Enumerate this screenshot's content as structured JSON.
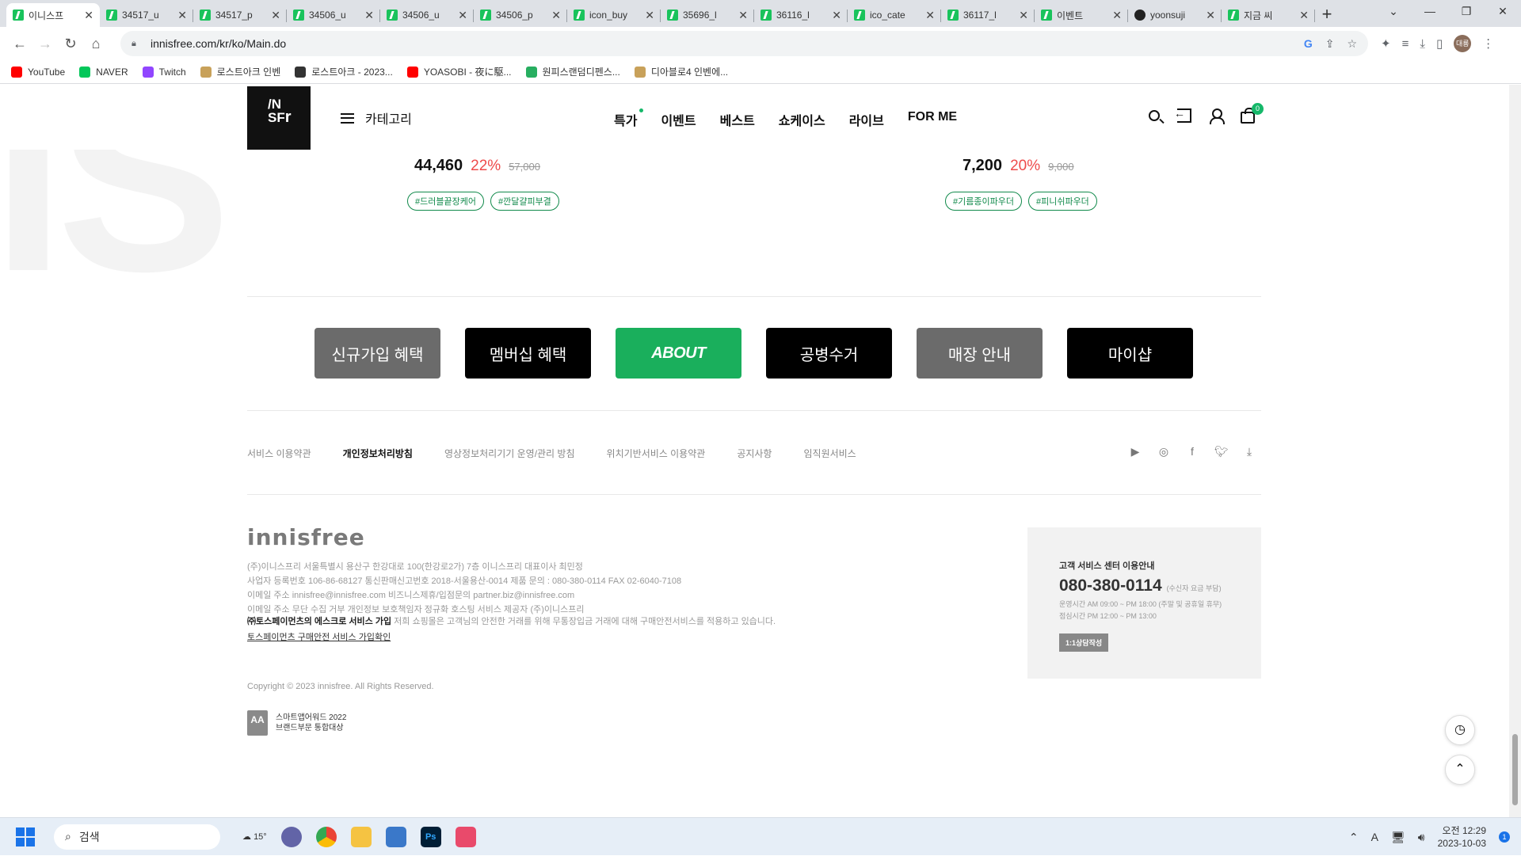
{
  "browser": {
    "tabs": [
      {
        "label": "이니스프",
        "active": true
      },
      {
        "label": "34517_u"
      },
      {
        "label": "34517_p"
      },
      {
        "label": "34506_u"
      },
      {
        "label": "34506_u"
      },
      {
        "label": "34506_p"
      },
      {
        "label": "icon_buy"
      },
      {
        "label": "35696_l"
      },
      {
        "label": "36116_l"
      },
      {
        "label": "ico_cate"
      },
      {
        "label": "36117_l"
      },
      {
        "label": "이벤트"
      },
      {
        "label": "yoonsuji",
        "github": true
      },
      {
        "label": "지금 씨"
      }
    ],
    "url": "innisfree.com/kr/ko/Main.do",
    "profile_initials": "대룡",
    "bookmarks": [
      {
        "label": "YouTube",
        "color": "#ff0000"
      },
      {
        "label": "NAVER",
        "color": "#03c75a"
      },
      {
        "label": "Twitch",
        "color": "#9146ff"
      },
      {
        "label": "로스트아크 인벤",
        "color": "#c8a15a"
      },
      {
        "label": "로스트아크 - 2023...",
        "color": "#333333"
      },
      {
        "label": "YOASOBI - 夜に駆...",
        "color": "#ff0000"
      },
      {
        "label": "원피스랜덤디펜스...",
        "color": "#27ae60"
      },
      {
        "label": "디아블로4 인벤에...",
        "color": "#c8a15a"
      }
    ]
  },
  "header": {
    "logo": "INSFr",
    "category_label": "카테고리",
    "nav": [
      {
        "label": "특가",
        "dot": true
      },
      {
        "label": "이벤트"
      },
      {
        "label": "베스트"
      },
      {
        "label": "쇼케이스"
      },
      {
        "label": "라이브"
      },
      {
        "label": "FOR ME"
      }
    ],
    "cart_count": "0"
  },
  "products": [
    {
      "price": "44,460",
      "discount": "22%",
      "original": "57,000",
      "tags": [
        "#드러블끝장케어",
        "#깐달걀피부결"
      ]
    },
    {
      "price": "7,200",
      "discount": "20%",
      "original": "9,000",
      "tags": [
        "#기름종이파우더",
        "#피니쉬파우더"
      ]
    }
  ],
  "quick_links": [
    {
      "label": "신규가입 혜택",
      "style": "gray"
    },
    {
      "label": "멤버십 혜택",
      "style": "black"
    },
    {
      "label": "ABOUT",
      "style": "green"
    },
    {
      "label": "공병수거",
      "style": "black"
    },
    {
      "label": "매장 안내",
      "style": "gray"
    },
    {
      "label": "마이샵",
      "style": "black"
    }
  ],
  "footer_links": [
    {
      "label": "서비스 이용약관"
    },
    {
      "label": "개인정보처리방침",
      "strong": true
    },
    {
      "label": "영상정보처리기기 운영/관리 방침"
    },
    {
      "label": "위치기반서비스 이용약관"
    },
    {
      "label": "공지사항"
    },
    {
      "label": "임직원서비스"
    }
  ],
  "social_icons": [
    "youtube-icon",
    "instagram-icon",
    "facebook-icon",
    "twitter-icon",
    "download-icon"
  ],
  "brand_logo": "innisfree",
  "company": {
    "line1": "(주)이니스프리 서울특별시 용산구 한강대로 100(한강로2가) 7층 이니스프리 대표이사 최민정",
    "line2": "사업자 등록번호 106-86-68127 통신판매신고번호 2018-서울용산-0014 제품 문의 : 080-380-0114 FAX 02-6040-7108",
    "line3": "이메일 주소 innisfree@innisfree.com 비즈니스제휴/입점문의 partner.biz@innisfree.com",
    "line4": "이메일 주소 무단 수집 거부 개인정보 보호책임자 정규화 호스팅 서비스 제공자 (주)이니스프리"
  },
  "escrow": {
    "bold": "㈜토스페이먼츠의 에스크로 서비스 가입",
    "text": " 저희 쇼핑몰은 고객님의 안전한 거래를 위해 무통장입금 거래에 대해 구매안전서비스를 적용하고 있습니다.",
    "link": "토스페이먼츠 구매안전 서비스 가입확인"
  },
  "copyright": "Copyright © 2023 innisfree. All Rights Reserved.",
  "award": {
    "badge": "AA",
    "line1": "스마트앱어워드 2022",
    "line2": "브랜드부문 통합대상"
  },
  "cs": {
    "title": "고객 서비스 센터 이용안내",
    "phone": "080-380-0114",
    "phone_note": "(수신자 요금 부담)",
    "hours1": "운영시간 AM 09:00 ~ PM 18:00 (주말 및 공휴일 휴무)",
    "hours2": "점심시간 PM 12:00 ~ PM 13:00",
    "button": "1:1상담작성"
  },
  "taskbar": {
    "search_placeholder": "검색",
    "weather": "15°",
    "time": "오전 12:29",
    "date": "2023-10-03",
    "notifications": "1",
    "ime": "A"
  }
}
